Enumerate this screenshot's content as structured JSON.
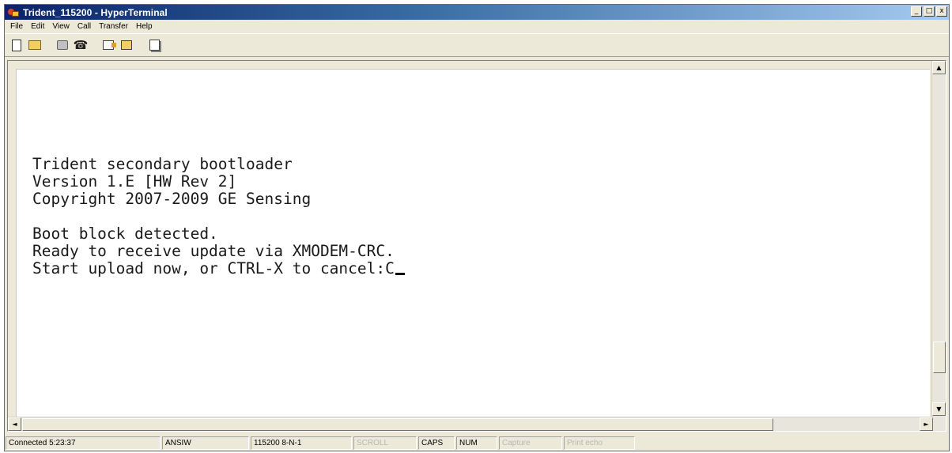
{
  "window": {
    "title": "Trident_115200 - HyperTerminal",
    "controls": {
      "minimize": "_",
      "maximize": "□",
      "close": "x"
    }
  },
  "menu": {
    "items": [
      "File",
      "Edit",
      "View",
      "Call",
      "Transfer",
      "Help"
    ]
  },
  "toolbar": {
    "buttons": [
      "new-icon",
      "open-icon",
      "call-icon",
      "disconnect-icon",
      "send-icon",
      "receive-icon",
      "properties-icon"
    ]
  },
  "terminal": {
    "lines": [
      "Trident secondary bootloader",
      "Version 1.E [HW Rev 2]",
      "Copyright 2007-2009 GE Sensing",
      "",
      "Boot block detected.",
      "Ready to receive update via XMODEM-CRC.",
      "Start upload now, or CTRL-X to cancel:C"
    ]
  },
  "scrollbars": {
    "up": "▲",
    "down": "▼",
    "left": "◄",
    "right": "►"
  },
  "status": {
    "connected": "Connected 5:23:37",
    "emulation": "ANSIW",
    "port_settings": "115200 8-N-1",
    "scroll": "SCROLL",
    "caps": "CAPS",
    "num": "NUM",
    "capture": "Capture",
    "print_echo": "Print echo"
  }
}
